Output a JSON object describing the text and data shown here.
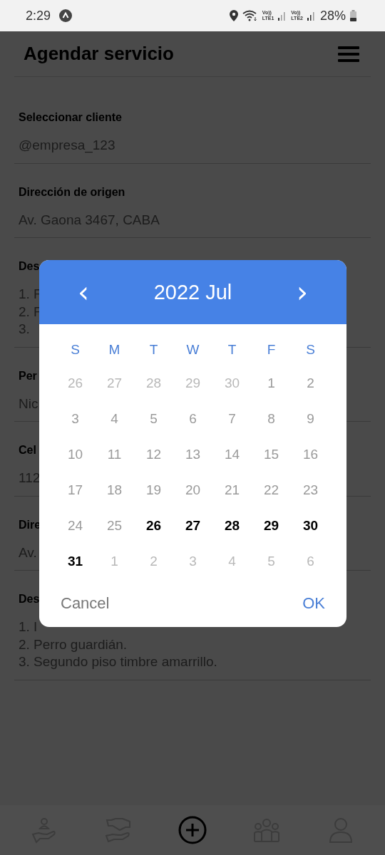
{
  "status_bar": {
    "time": "2:29",
    "sim1": {
      "top": "Vo))",
      "bottom": "LTE1"
    },
    "sim2": {
      "top": "Vo))",
      "bottom": "LTE2"
    },
    "battery": "28%"
  },
  "app_bar": {
    "title": "Agendar servicio"
  },
  "fields": [
    {
      "label": "Seleccionar cliente",
      "lines": [
        "@empresa_123"
      ]
    },
    {
      "label": "Dirección de origen",
      "lines": [
        "Av. Gaona 3467, CABA"
      ]
    },
    {
      "label": "Des",
      "lines": [
        "1. F",
        "2. F",
        "3."
      ]
    },
    {
      "label": "Per",
      "lines": [
        "Nic"
      ]
    },
    {
      "label": "Cel",
      "lines": [
        "112"
      ]
    },
    {
      "label": "Dire",
      "lines": [
        "Av."
      ]
    },
    {
      "label": "Des",
      "lines": [
        "1. I",
        "2. Perro guardián.",
        "3. Segundo piso timbre amarrillo."
      ]
    }
  ],
  "date_picker": {
    "prev": "‹",
    "title": "2022 Jul",
    "next": "›",
    "weekdays": [
      "S",
      "M",
      "T",
      "W",
      "T",
      "F",
      "S"
    ],
    "days": [
      {
        "day": "26",
        "kind": "other"
      },
      {
        "day": "27",
        "kind": "other"
      },
      {
        "day": "28",
        "kind": "other"
      },
      {
        "day": "29",
        "kind": "other"
      },
      {
        "day": "30",
        "kind": "other"
      },
      {
        "day": "1",
        "kind": "disabled"
      },
      {
        "day": "2",
        "kind": "disabled"
      },
      {
        "day": "3",
        "kind": "disabled"
      },
      {
        "day": "4",
        "kind": "disabled"
      },
      {
        "day": "5",
        "kind": "disabled"
      },
      {
        "day": "6",
        "kind": "disabled"
      },
      {
        "day": "7",
        "kind": "disabled"
      },
      {
        "day": "8",
        "kind": "disabled"
      },
      {
        "day": "9",
        "kind": "disabled"
      },
      {
        "day": "10",
        "kind": "disabled"
      },
      {
        "day": "11",
        "kind": "disabled"
      },
      {
        "day": "12",
        "kind": "disabled"
      },
      {
        "day": "13",
        "kind": "disabled"
      },
      {
        "day": "14",
        "kind": "disabled"
      },
      {
        "day": "15",
        "kind": "disabled"
      },
      {
        "day": "16",
        "kind": "disabled"
      },
      {
        "day": "17",
        "kind": "disabled"
      },
      {
        "day": "18",
        "kind": "disabled"
      },
      {
        "day": "19",
        "kind": "disabled"
      },
      {
        "day": "20",
        "kind": "disabled"
      },
      {
        "day": "21",
        "kind": "disabled"
      },
      {
        "day": "22",
        "kind": "disabled"
      },
      {
        "day": "23",
        "kind": "disabled"
      },
      {
        "day": "24",
        "kind": "disabled"
      },
      {
        "day": "25",
        "kind": "disabled"
      },
      {
        "day": "26",
        "kind": "enabled"
      },
      {
        "day": "27",
        "kind": "enabled"
      },
      {
        "day": "28",
        "kind": "enabled"
      },
      {
        "day": "29",
        "kind": "enabled"
      },
      {
        "day": "30",
        "kind": "enabled"
      },
      {
        "day": "31",
        "kind": "enabled"
      },
      {
        "day": "1",
        "kind": "other"
      },
      {
        "day": "2",
        "kind": "other"
      },
      {
        "day": "3",
        "kind": "other"
      },
      {
        "day": "4",
        "kind": "other"
      },
      {
        "day": "5",
        "kind": "other"
      },
      {
        "day": "6",
        "kind": "other"
      }
    ],
    "cancel": "Cancel",
    "ok": "OK"
  },
  "bottom_nav": [
    {
      "kind": "hand-person",
      "selected": false
    },
    {
      "kind": "handshake",
      "selected": false
    },
    {
      "kind": "add",
      "selected": true
    },
    {
      "kind": "group",
      "selected": false
    },
    {
      "kind": "person",
      "selected": false
    }
  ]
}
